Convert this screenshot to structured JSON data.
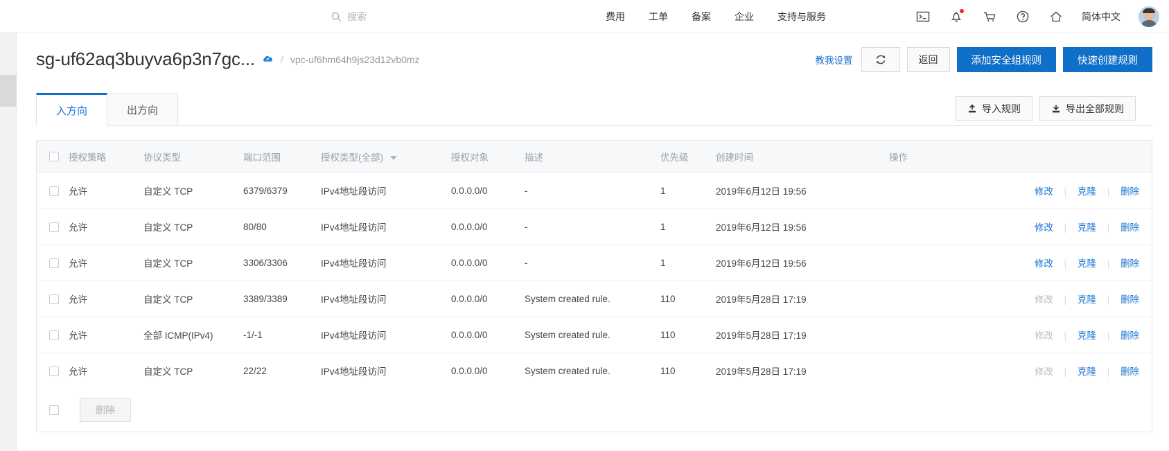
{
  "colors": {
    "brand_blue": "#1070c8",
    "link_blue": "#1974d2",
    "header_bg": "#f7f8fa",
    "badge_red": "#f5222d",
    "rail_gray": "#f2f2f2"
  },
  "topnav": {
    "search": {
      "placeholder": "搜索",
      "value": "",
      "icon": "search-icon"
    },
    "links": [
      {
        "label": "费用"
      },
      {
        "label": "工单"
      },
      {
        "label": "备案"
      },
      {
        "label": "企业"
      },
      {
        "label": "支持与服务"
      }
    ],
    "icons": [
      {
        "name": "terminal-icon"
      },
      {
        "name": "bell-icon",
        "badge": true
      },
      {
        "name": "cart-icon"
      },
      {
        "name": "help-icon"
      },
      {
        "name": "home-icon"
      }
    ],
    "language": "简体中文",
    "avatar": "user-avatar"
  },
  "header": {
    "title": "sg-uf62aq3buyva6p3n7gc...",
    "cloud_icon": "security-group-icon",
    "breadcrumb_separator": "/",
    "vpc_id": "vpc-uf6hm64h9js23d12vb0mz",
    "teach_me_link": "教我设置",
    "refresh_icon": "refresh-icon",
    "back_button": "返回",
    "add_rule_button": "添加安全组规则",
    "quick_create_button": "快速创建规则"
  },
  "tabs": [
    {
      "label": "入方向",
      "active": true
    },
    {
      "label": "出方向",
      "active": false
    }
  ],
  "toolbar": {
    "import_label": "导入规则",
    "import_icon": "upload-icon",
    "export_label": "导出全部规则",
    "export_icon": "download-icon"
  },
  "table": {
    "columns": [
      {
        "key": "checkbox",
        "label": ""
      },
      {
        "key": "policy",
        "label": "授权策略"
      },
      {
        "key": "protocol",
        "label": "协议类型"
      },
      {
        "key": "port",
        "label": "端口范围"
      },
      {
        "key": "auth_type",
        "label": "授权类型(全部)",
        "filterable": true
      },
      {
        "key": "auth_object",
        "label": "授权对象"
      },
      {
        "key": "description",
        "label": "描述"
      },
      {
        "key": "priority",
        "label": "优先级"
      },
      {
        "key": "created",
        "label": "创建时间"
      },
      {
        "key": "actions",
        "label": "操作"
      }
    ],
    "rows": [
      {
        "policy": "允许",
        "protocol": "自定义 TCP",
        "port": "6379/6379",
        "auth_type": "IPv4地址段访问",
        "auth_object": "0.0.0.0/0",
        "description": "-",
        "priority": "1",
        "created": "2019年6月12日 19:56",
        "edit_label": "修改",
        "edit_disabled": false,
        "clone_label": "克隆",
        "delete_label": "删除"
      },
      {
        "policy": "允许",
        "protocol": "自定义 TCP",
        "port": "80/80",
        "auth_type": "IPv4地址段访问",
        "auth_object": "0.0.0.0/0",
        "description": "-",
        "priority": "1",
        "created": "2019年6月12日 19:56",
        "edit_label": "修改",
        "edit_disabled": false,
        "clone_label": "克隆",
        "delete_label": "删除"
      },
      {
        "policy": "允许",
        "protocol": "自定义 TCP",
        "port": "3306/3306",
        "auth_type": "IPv4地址段访问",
        "auth_object": "0.0.0.0/0",
        "description": "-",
        "priority": "1",
        "created": "2019年6月12日 19:56",
        "edit_label": "修改",
        "edit_disabled": false,
        "clone_label": "克隆",
        "delete_label": "删除"
      },
      {
        "policy": "允许",
        "protocol": "自定义 TCP",
        "port": "3389/3389",
        "auth_type": "IPv4地址段访问",
        "auth_object": "0.0.0.0/0",
        "description": "System created rule.",
        "priority": "110",
        "created": "2019年5月28日 17:19",
        "edit_label": "修改",
        "edit_disabled": true,
        "clone_label": "克隆",
        "delete_label": "删除"
      },
      {
        "policy": "允许",
        "protocol": "全部 ICMP(IPv4)",
        "port": "-1/-1",
        "auth_type": "IPv4地址段访问",
        "auth_object": "0.0.0.0/0",
        "description": "System created rule.",
        "priority": "110",
        "created": "2019年5月28日 17:19",
        "edit_label": "修改",
        "edit_disabled": true,
        "clone_label": "克隆",
        "delete_label": "删除"
      },
      {
        "policy": "允许",
        "protocol": "自定义 TCP",
        "port": "22/22",
        "auth_type": "IPv4地址段访问",
        "auth_object": "0.0.0.0/0",
        "description": "System created rule.",
        "priority": "110",
        "created": "2019年5月28日 17:19",
        "edit_label": "修改",
        "edit_disabled": true,
        "clone_label": "克隆",
        "delete_label": "删除"
      }
    ],
    "footer": {
      "delete_label": "删除",
      "delete_disabled": true
    }
  }
}
